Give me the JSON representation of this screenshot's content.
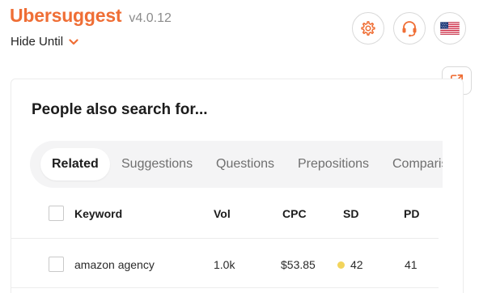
{
  "header": {
    "brand_name": "Ubersuggest",
    "version": "v4.0.12",
    "hide_until_label": "Hide Until"
  },
  "colors": {
    "brand": "#ef6e35",
    "sd_easy": "#f2d45c"
  },
  "icons": {
    "settings": "gear-icon",
    "support": "headset-icon",
    "flag": "us-flag-icon",
    "external": "external-link-icon",
    "dropdown": "chevron-down-icon"
  },
  "card": {
    "title": "People also search for..."
  },
  "tabs": [
    {
      "label": "Related",
      "active": true
    },
    {
      "label": "Suggestions",
      "active": false
    },
    {
      "label": "Questions",
      "active": false
    },
    {
      "label": "Prepositions",
      "active": false
    },
    {
      "label": "Comparisons",
      "active": false
    }
  ],
  "table": {
    "columns": {
      "keyword": "Keyword",
      "vol": "Vol",
      "cpc": "CPC",
      "sd": "SD",
      "pd": "PD"
    },
    "rows": [
      {
        "keyword": "amazon agency",
        "vol": "1.0k",
        "cpc": "$53.85",
        "sd": "42",
        "pd": "41"
      }
    ]
  }
}
